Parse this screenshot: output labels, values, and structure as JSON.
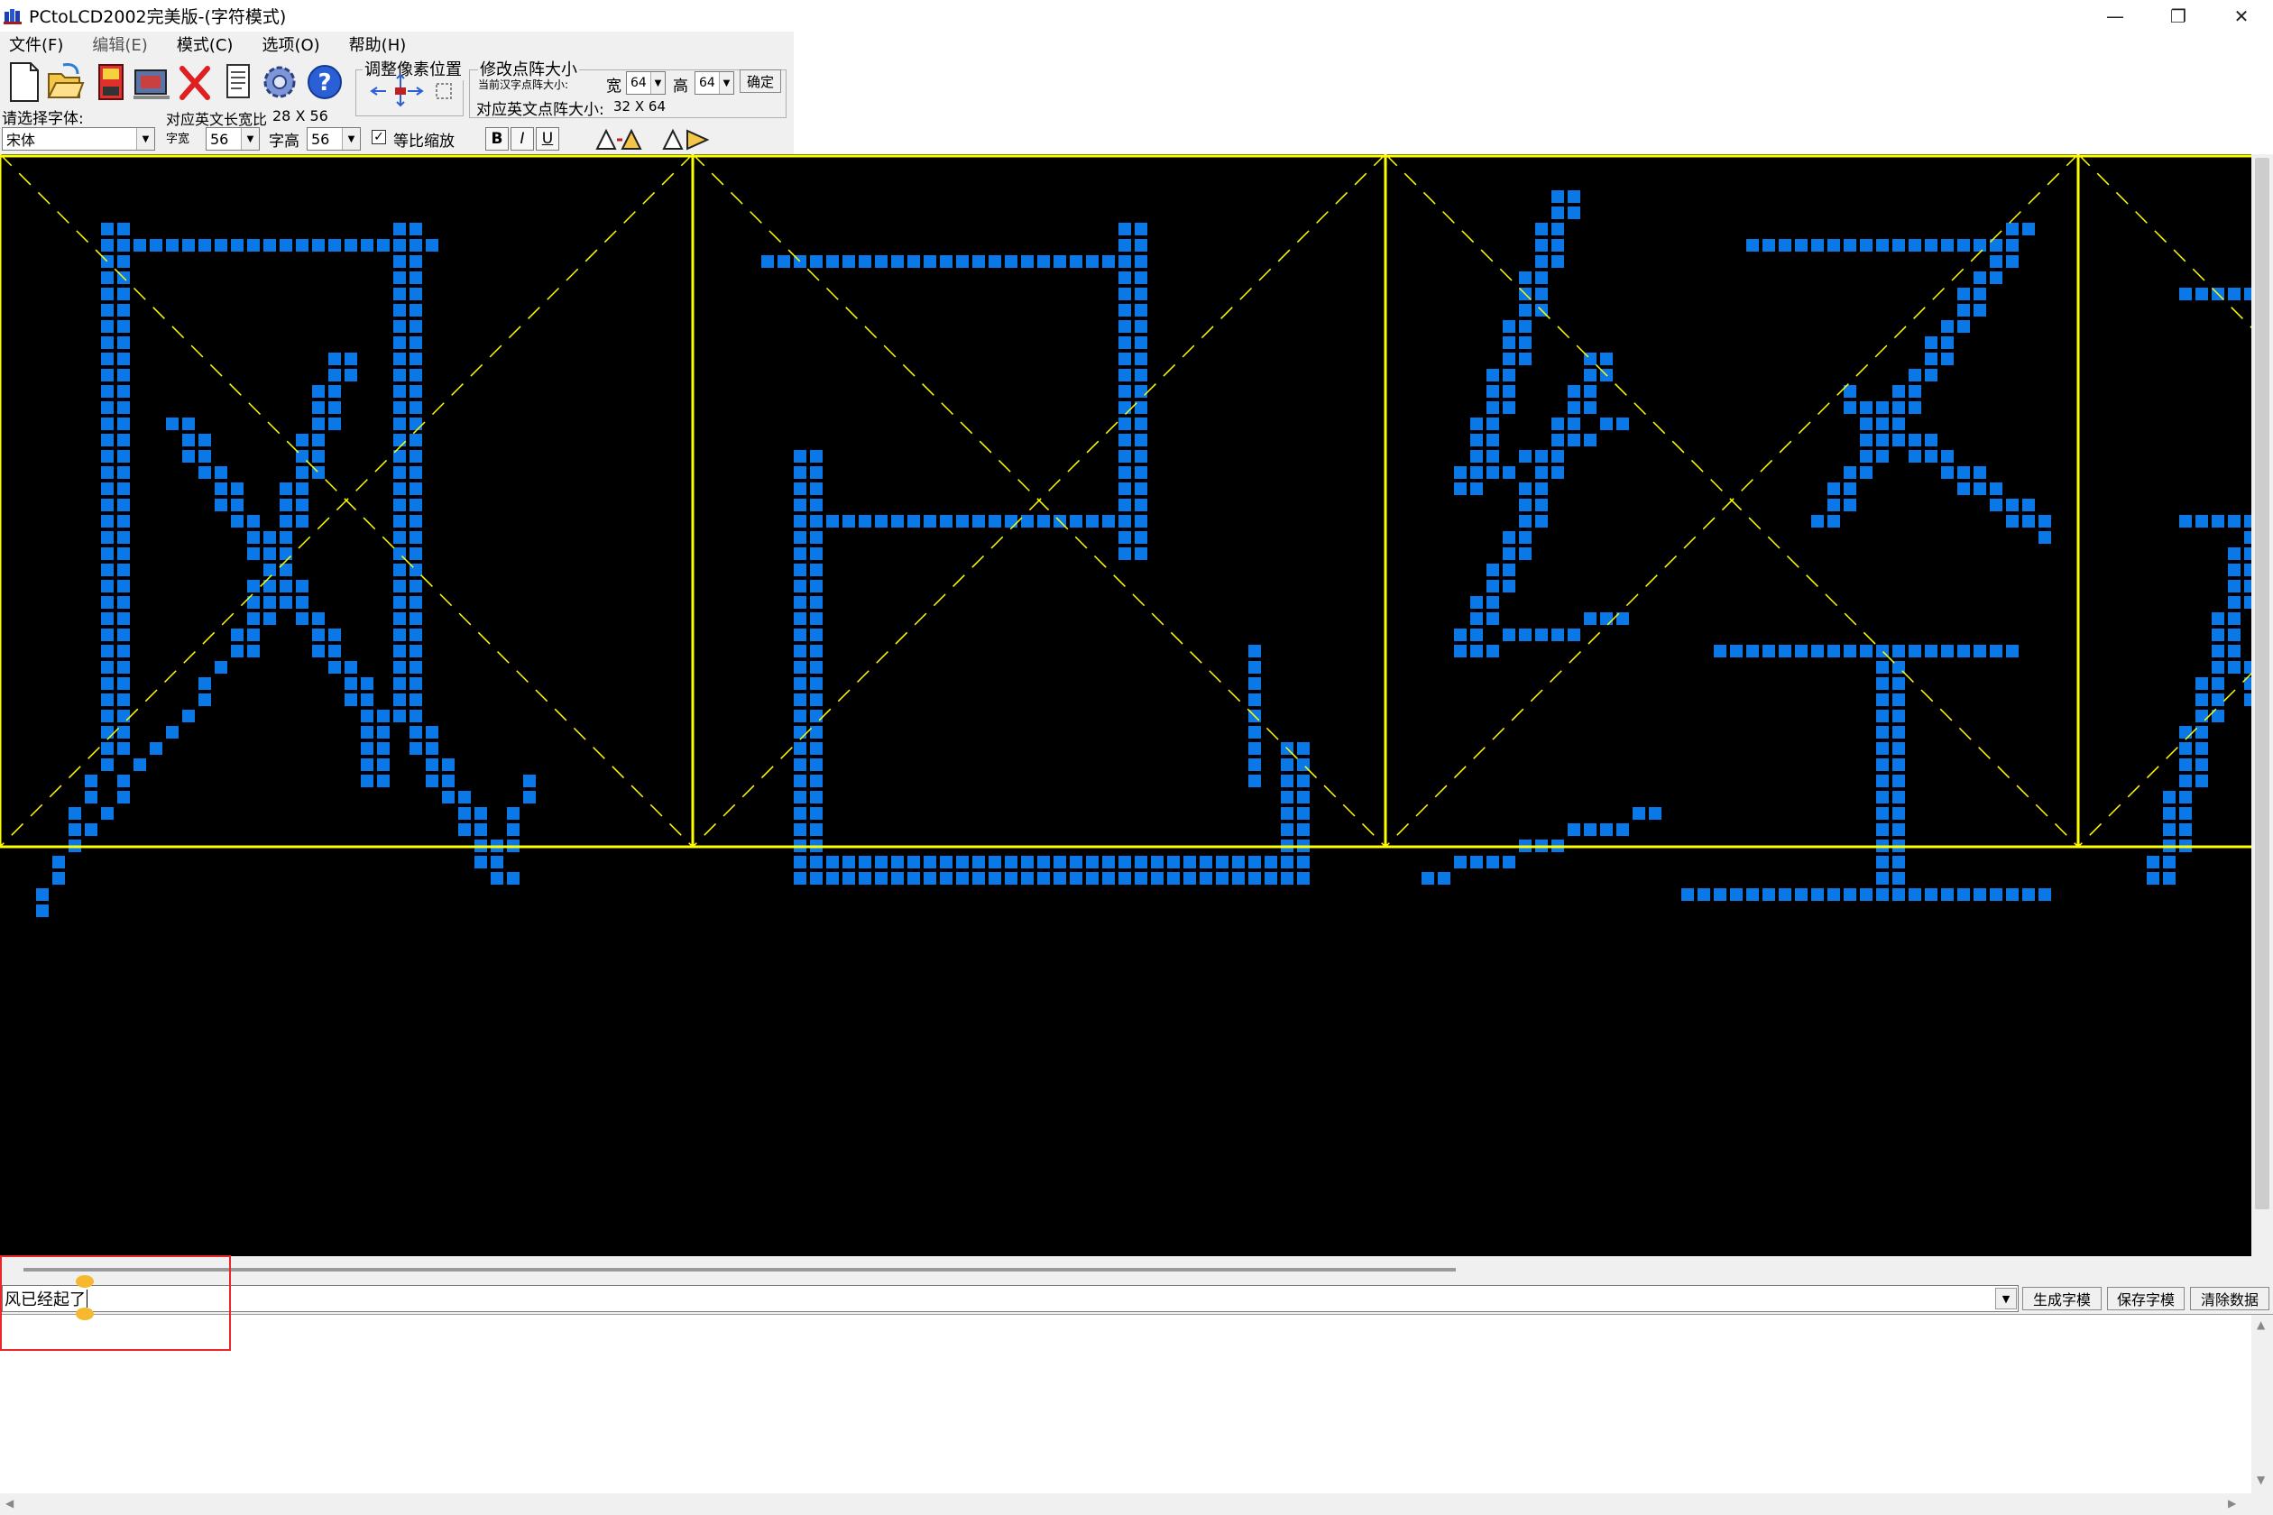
{
  "window": {
    "title": "PCtoLCD2002完美版-(字符模式)",
    "minimize_glyph": "—",
    "restore_glyph": "❐",
    "close_glyph": "✕"
  },
  "menu": {
    "items": [
      "文件(F)",
      "编辑(E)",
      "模式(C)",
      "选项(O)",
      "帮助(H)"
    ]
  },
  "toolbar": {
    "font_label": "请选择字体:",
    "font_value": "宋体",
    "ratio_label": "对应英文长宽比",
    "ratio_value": "28 X 56",
    "char_width_label": "字宽",
    "char_width_value": "56",
    "char_height_label": "字高",
    "char_height_value": "56",
    "proportional_label": "等比缩放",
    "proportional_checked": "✓",
    "bold_label": "B",
    "italic_label": "I",
    "underline_label": "U",
    "adjust_group_title": "调整像素位置",
    "matrix_group_title": "修改点阵大小",
    "matrix_current_label": "当前汉字点阵大小:",
    "matrix_width_label": "宽",
    "matrix_width_value": "64",
    "matrix_height_label": "高",
    "matrix_height_value": "64",
    "matrix_confirm_label": "确定",
    "english_matrix_label": "对应英文点阵大小:",
    "english_matrix_value": "32 X 64"
  },
  "canvas": {
    "grid_color": "#ffff00",
    "pixel_color": "#0a78e6",
    "background": "#000000",
    "characters": [
      "风",
      "已",
      "经",
      "起"
    ],
    "cell_size_px": 768
  },
  "input": {
    "text_value": "风已经起了",
    "generate_button": "生成字模",
    "save_button": "保存字模",
    "clear_button": "清除数据"
  },
  "icons": {
    "new": "new-file-icon",
    "open": "open-folder-icon",
    "save": "save-icon",
    "settings": "settings-icon",
    "delete": "delete-icon",
    "copy": "document-icon",
    "gear": "gear-icon",
    "help": "help-icon"
  }
}
